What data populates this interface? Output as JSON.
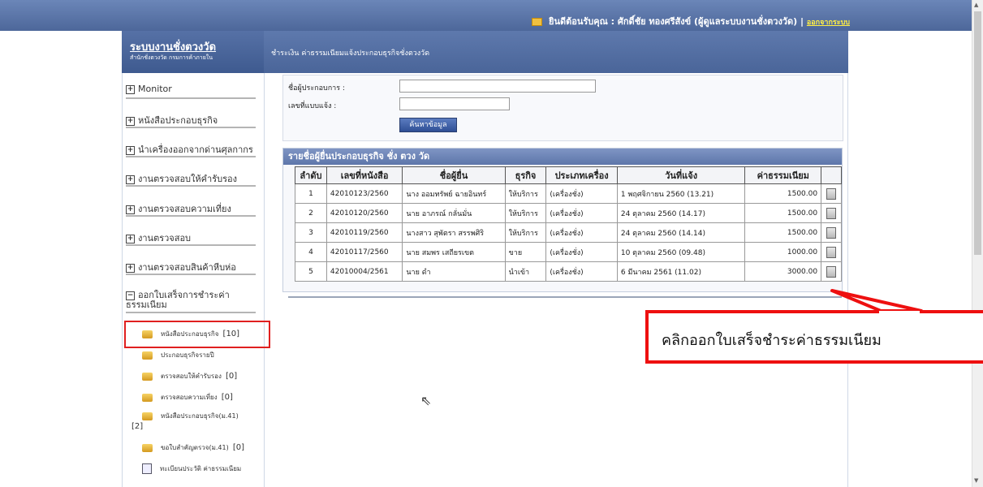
{
  "header": {
    "welcome": "ยินดีต้อนรับคุณ : ศักดิ์ชัย ทองศรีสังข์ (ผู้ดูแลระบบงานชั่งตวงวัด) |",
    "logout": "ออกจากระบบ"
  },
  "brand": {
    "title": "ระบบงานชั่งตวงวัด",
    "subtitle": "สำนักชั่งตวงวัด กรมการค้าภายใน"
  },
  "breadcrumb": "ชำระเงิน ค่าธรรมเนียมแจ้งประกอบธุรกิจชั่งตวงวัด",
  "menu": [
    {
      "label": "Monitor",
      "toggle": "+"
    },
    {
      "label": "หนังสือประกอบธุรกิจ",
      "toggle": "+"
    },
    {
      "label": "นำเครื่องออกจากด่านศุลกากร",
      "toggle": "+"
    },
    {
      "label": "งานตรวจสอบให้คำรับรอง",
      "toggle": "+"
    },
    {
      "label": "งานตรวจสอบความเที่ยง",
      "toggle": "+"
    },
    {
      "label": "งานตรวจสอบ",
      "toggle": "+"
    },
    {
      "label": "งานตรวจสอบสินค้าหีบห่อ",
      "toggle": "+"
    },
    {
      "label": "ออกใบเสร็จการชำระค่าธรรมเนียม",
      "toggle": "−"
    }
  ],
  "submenu": [
    {
      "label": "หนังสือประกอบธุรกิจ",
      "count": "[10]"
    },
    {
      "label": "ประกอบธุรกิจรายปี",
      "count": ""
    },
    {
      "label": "ตรวจสอบให้คำรับรอง",
      "count": "[0]"
    },
    {
      "label": "ตรวจสอบความเที่ยง",
      "count": "[0]"
    },
    {
      "label": "หนังสือประกอบธุรกิจ(ม.41)",
      "count": "[2]"
    },
    {
      "label": "ขอใบสำคัญตรวจ(ม.41)",
      "count": "[0]"
    },
    {
      "label": "ทะเบียนประวัติ ค่าธรรมเนียม",
      "count": ""
    }
  ],
  "search": {
    "operator_label": "ชื่อผู้ประกอบการ :",
    "form_no_label": "เลขที่แบบแจ้ง :",
    "operator_value": "",
    "form_no_value": "",
    "button": "ค้นหาข้อมูล"
  },
  "table": {
    "heading": "รายชื่อผู้ยื่นประกอบธุรกิจ ชั่ง ตวง วัด",
    "columns": [
      "ลำดับ",
      "เลขที่หนังสือ",
      "ชื่อผู้ยื่น",
      "ธุรกิจ",
      "ประเภทเครื่อง",
      "วันที่แจ้ง",
      "ค่าธรรมเนียม"
    ],
    "rows": [
      [
        "1",
        "42010123/2560",
        "นาง ออมทรัพย์ ฉายอินทร์",
        "ให้บริการ",
        "(เครื่องชั่ง)",
        "1 พฤศจิกายน 2560 (13.21)",
        "1500.00"
      ],
      [
        "2",
        "42010120/2560",
        "นาย อาภรณ์ กลั่นมั่น",
        "ให้บริการ",
        "(เครื่องชั่ง)",
        "24 ตุลาคม 2560 (14.17)",
        "1500.00"
      ],
      [
        "3",
        "42010119/2560",
        "นางสาว สุพัตรา สรรพศิริ",
        "ให้บริการ",
        "(เครื่องชั่ง)",
        "24 ตุลาคม 2560 (14.14)",
        "1500.00"
      ],
      [
        "4",
        "42010117/2560",
        "นาย สมพร เสถียรเขต",
        "ขาย",
        "(เครื่องชั่ง)",
        "10 ตุลาคม 2560 (09.48)",
        "1000.00"
      ],
      [
        "5",
        "42010004/2561",
        "นาย ดำ",
        "นำเข้า",
        "(เครื่องชั่ง)",
        "6 มีนาคม 2561 (11.02)",
        "3000.00"
      ]
    ]
  },
  "callout": "คลิกออกใบเสร็จชำระค่าธรรมเนียม"
}
